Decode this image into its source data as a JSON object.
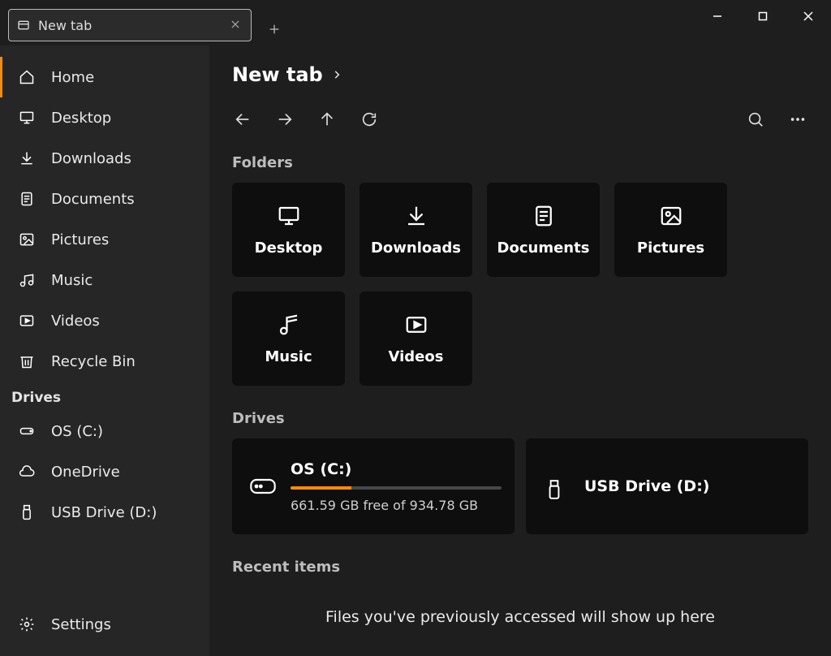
{
  "titlebar": {
    "tab_title": "New tab"
  },
  "sidebar": {
    "items": [
      {
        "id": "home",
        "label": "Home",
        "active": true
      },
      {
        "id": "desktop",
        "label": "Desktop",
        "active": false
      },
      {
        "id": "downloads",
        "label": "Downloads",
        "active": false
      },
      {
        "id": "documents",
        "label": "Documents",
        "active": false
      },
      {
        "id": "pictures",
        "label": "Pictures",
        "active": false
      },
      {
        "id": "music",
        "label": "Music",
        "active": false
      },
      {
        "id": "videos",
        "label": "Videos",
        "active": false
      },
      {
        "id": "recycle-bin",
        "label": "Recycle Bin",
        "active": false
      }
    ],
    "drives_header": "Drives",
    "drive_items": [
      {
        "id": "drive-c",
        "label": "OS (C:)"
      },
      {
        "id": "onedrive",
        "label": "OneDrive"
      },
      {
        "id": "drive-d",
        "label": "USB Drive (D:)"
      }
    ],
    "settings_label": "Settings"
  },
  "main": {
    "title": "New tab",
    "sections": {
      "folders_title": "Folders",
      "drives_title": "Drives",
      "recent_title": "Recent items",
      "recent_empty_text": "Files you've previously accessed will show up here"
    },
    "folders": [
      {
        "id": "desktop",
        "label": "Desktop"
      },
      {
        "id": "downloads",
        "label": "Downloads"
      },
      {
        "id": "documents",
        "label": "Documents"
      },
      {
        "id": "pictures",
        "label": "Pictures"
      },
      {
        "id": "music",
        "label": "Music"
      },
      {
        "id": "videos",
        "label": "Videos"
      }
    ],
    "drives": [
      {
        "id": "drive-c",
        "label": "OS (C:)",
        "free_text": "661.59 GB free of 934.78 GB",
        "fill_percent": 29
      },
      {
        "id": "drive-d",
        "label": "USB Drive (D:)",
        "free_text": "",
        "fill_percent": 0
      }
    ]
  },
  "colors": {
    "accent": "#ff8c00",
    "sidebar_bg": "#262626",
    "main_bg": "#1e1e1e",
    "card_bg": "#0e0e0e"
  }
}
